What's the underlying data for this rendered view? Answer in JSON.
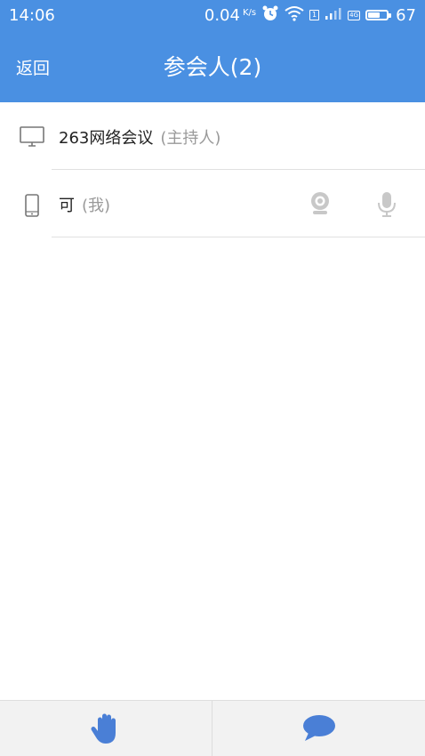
{
  "status_bar": {
    "time": "14:06",
    "net_speed": "0.04",
    "net_unit": "K/s",
    "network_badge": "4G",
    "sim_slot": "1",
    "battery_percent": "67",
    "battery_level": 0.67
  },
  "title_bar": {
    "back_label": "返回",
    "title": "参会人(2)"
  },
  "participants": [
    {
      "name": "263网络会议",
      "role": "(主持人)",
      "device_icon": "monitor-icon"
    },
    {
      "name": "可",
      "role": "(我)",
      "device_icon": "phone-icon",
      "camera_icon": "camera-icon",
      "mic_icon": "microphone-icon"
    }
  ],
  "bottom_bar": {
    "left_icon": "raise-hand-icon",
    "right_icon": "chat-icon"
  },
  "colors": {
    "primary": "#4a90e2",
    "bottom_bar_bg": "#f2f2f2",
    "muted_text": "#999999",
    "disabled_icon": "#c8c8c8"
  }
}
